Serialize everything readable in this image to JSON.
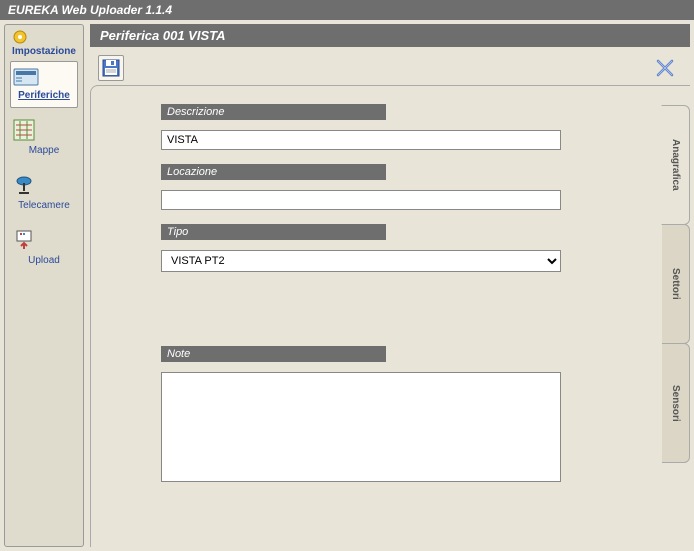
{
  "app_title": "EUREKA Web Uploader 1.1.4",
  "sidebar": {
    "header": "Impostazione",
    "items": [
      {
        "label": "Periferiche"
      },
      {
        "label": "Mappe"
      },
      {
        "label": "Telecamere"
      },
      {
        "label": "Upload"
      }
    ]
  },
  "page": {
    "title": "Periferica 001 VISTA"
  },
  "form": {
    "descrizione_label": "Descrizione",
    "descrizione_value": "VISTA",
    "locazione_label": "Locazione",
    "locazione_value": "",
    "tipo_label": "Tipo",
    "tipo_value": "VISTA PT2",
    "note_label": "Note",
    "note_value": ""
  },
  "tabs": [
    {
      "label": "Anagrafica"
    },
    {
      "label": "Settori"
    },
    {
      "label": "Sensori"
    }
  ]
}
